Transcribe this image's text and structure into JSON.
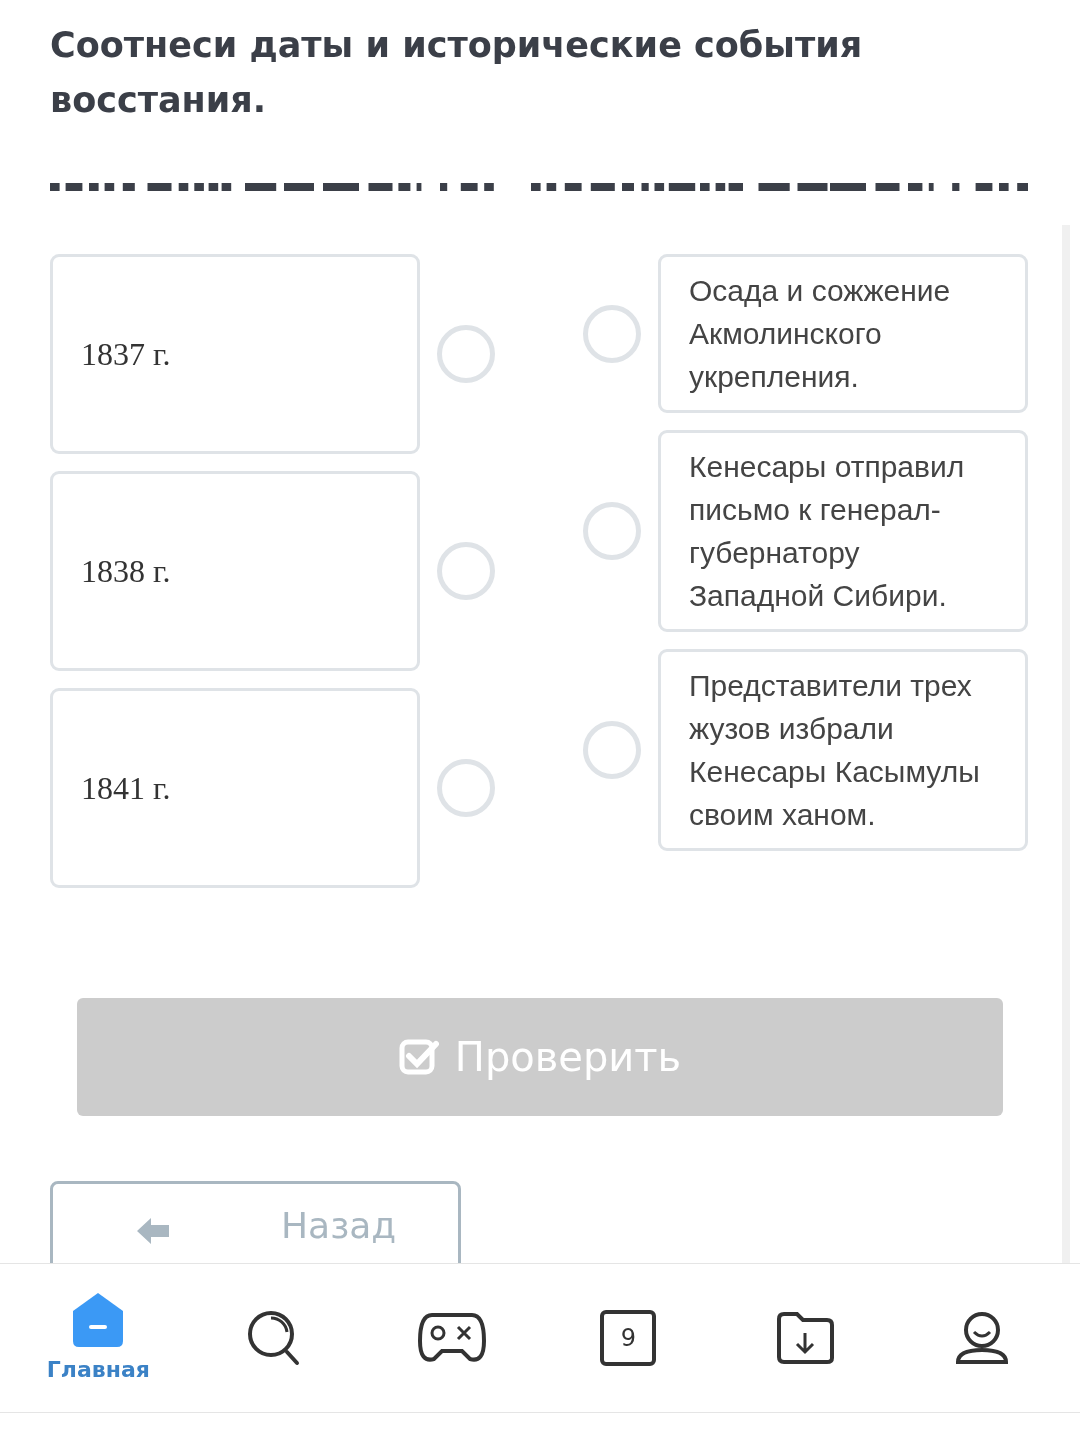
{
  "question": {
    "title": "Соотнеси даты и исторические события восстания."
  },
  "left_items": [
    {
      "text": "1837 г.",
      "selected": false
    },
    {
      "text": "1838 г.",
      "selected": false
    },
    {
      "text": "1841 г.",
      "selected": false
    }
  ],
  "right_items": [
    {
      "text": "Осада и сожжение Акмолинского укрепления.",
      "selected": false
    },
    {
      "text": "Кенесары отправил письмо к генерал-губернатору Западной Сибири.",
      "selected": false
    },
    {
      "text": "Представители трех жузов избрали Кенесары Касымулы своим ханом.",
      "selected": false
    }
  ],
  "check_button": {
    "label": "Проверить",
    "disabled": true
  },
  "back_button": {
    "label": "Назад"
  },
  "bottom_nav": [
    {
      "kind": "home",
      "label": "Главная",
      "selected": true
    },
    {
      "kind": "search",
      "selected": false
    },
    {
      "kind": "game",
      "selected": false
    },
    {
      "kind": "counter",
      "text": "9",
      "selected": false
    },
    {
      "kind": "folder",
      "selected": false
    },
    {
      "kind": "profile",
      "selected": false
    }
  ]
}
